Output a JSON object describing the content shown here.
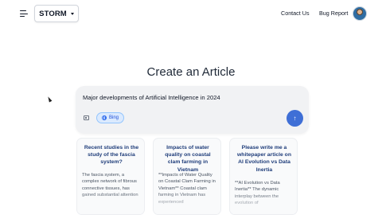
{
  "header": {
    "brand": "STORM",
    "nav": [
      {
        "label": "Contact Us"
      },
      {
        "label": "Bug Report"
      }
    ]
  },
  "main": {
    "title": "Create an Article",
    "search": {
      "value": "Major developments of Artificial Intelligence in 2024",
      "source_label": "Bing"
    },
    "cards": [
      {
        "title": "Recent studies in the study of the fascia system?",
        "body": "The fascia system, a complex network of fibrous connective tissues, has gained substantial attention"
      },
      {
        "title": "Impacts of water quality on coastal clam farming in Vietnam",
        "body": "**Impacts of Water Quality on Coastal Clam Farming in Vietnam** Coastal clam farming in Vietnam has experienced"
      },
      {
        "title": "Please write me a whitepaper article on AI Evolution vs Data Inertia",
        "body": "**AI Evolution vs Data Inertia** The dynamic interplay between the evolution of"
      }
    ]
  },
  "colors": {
    "accent": "#3f6fd6",
    "card_title": "#1f3d7a",
    "pill_bg": "#dbeafe"
  },
  "icons": [
    "menu-icon",
    "chevron-down-icon",
    "avatar",
    "attach-icon",
    "globe-icon",
    "arrow-up-icon"
  ]
}
